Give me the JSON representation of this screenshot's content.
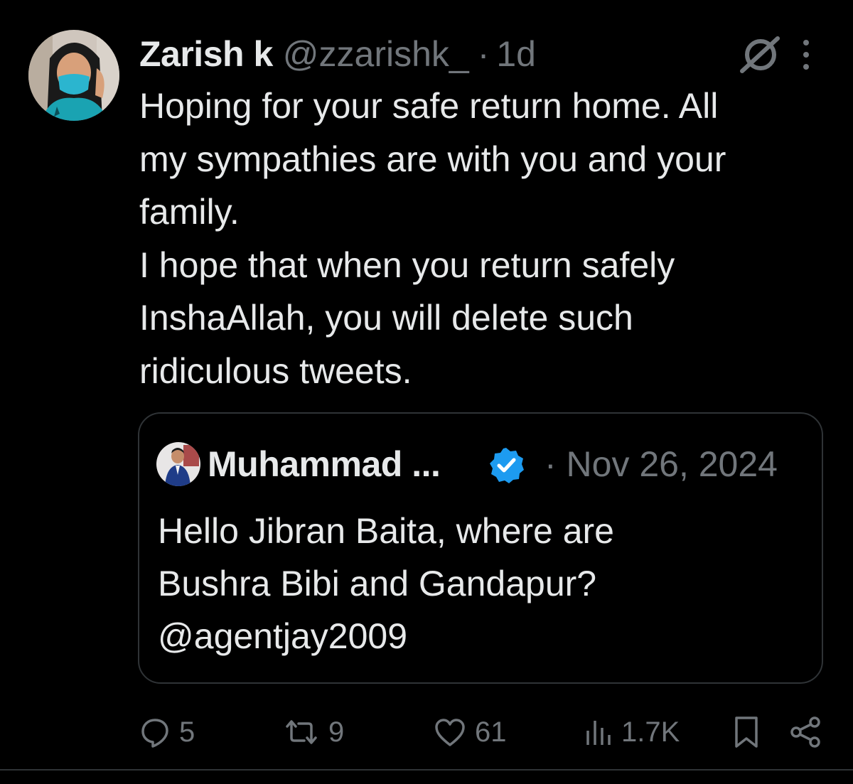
{
  "tweet": {
    "author_name": "Zarish k",
    "author_handle": "@zzarishk_",
    "separator": "·",
    "time": "1d",
    "text_lines": [
      "Hoping for your safe return home. All",
      "my sympathies are with you and your",
      "family.",
      "I hope that when you return safely",
      "InshaAllah, you will delete such",
      "ridiculous tweets."
    ]
  },
  "quote": {
    "author_name": "Muhammad ...",
    "date": "· Nov 26, 2024",
    "text_lines": [
      "Hello Jibran Baita, where are",
      "Bushra Bibi and Gandapur?",
      "@agentjay2009"
    ]
  },
  "actions": {
    "replies": "5",
    "reposts": "9",
    "likes": "61",
    "views": "1.7K"
  },
  "icons": {
    "grok": "grok-icon",
    "more": "more-icon",
    "verified": "verified-badge-icon",
    "reply": "reply-icon",
    "repost": "repost-icon",
    "like": "heart-icon",
    "views": "views-icon",
    "bookmark": "bookmark-icon",
    "share": "share-icon"
  },
  "colors": {
    "background": "#000000",
    "text": "#e7e9ea",
    "secondary": "#71767b",
    "border": "#2f3336",
    "verified": "#1d9bf0"
  }
}
